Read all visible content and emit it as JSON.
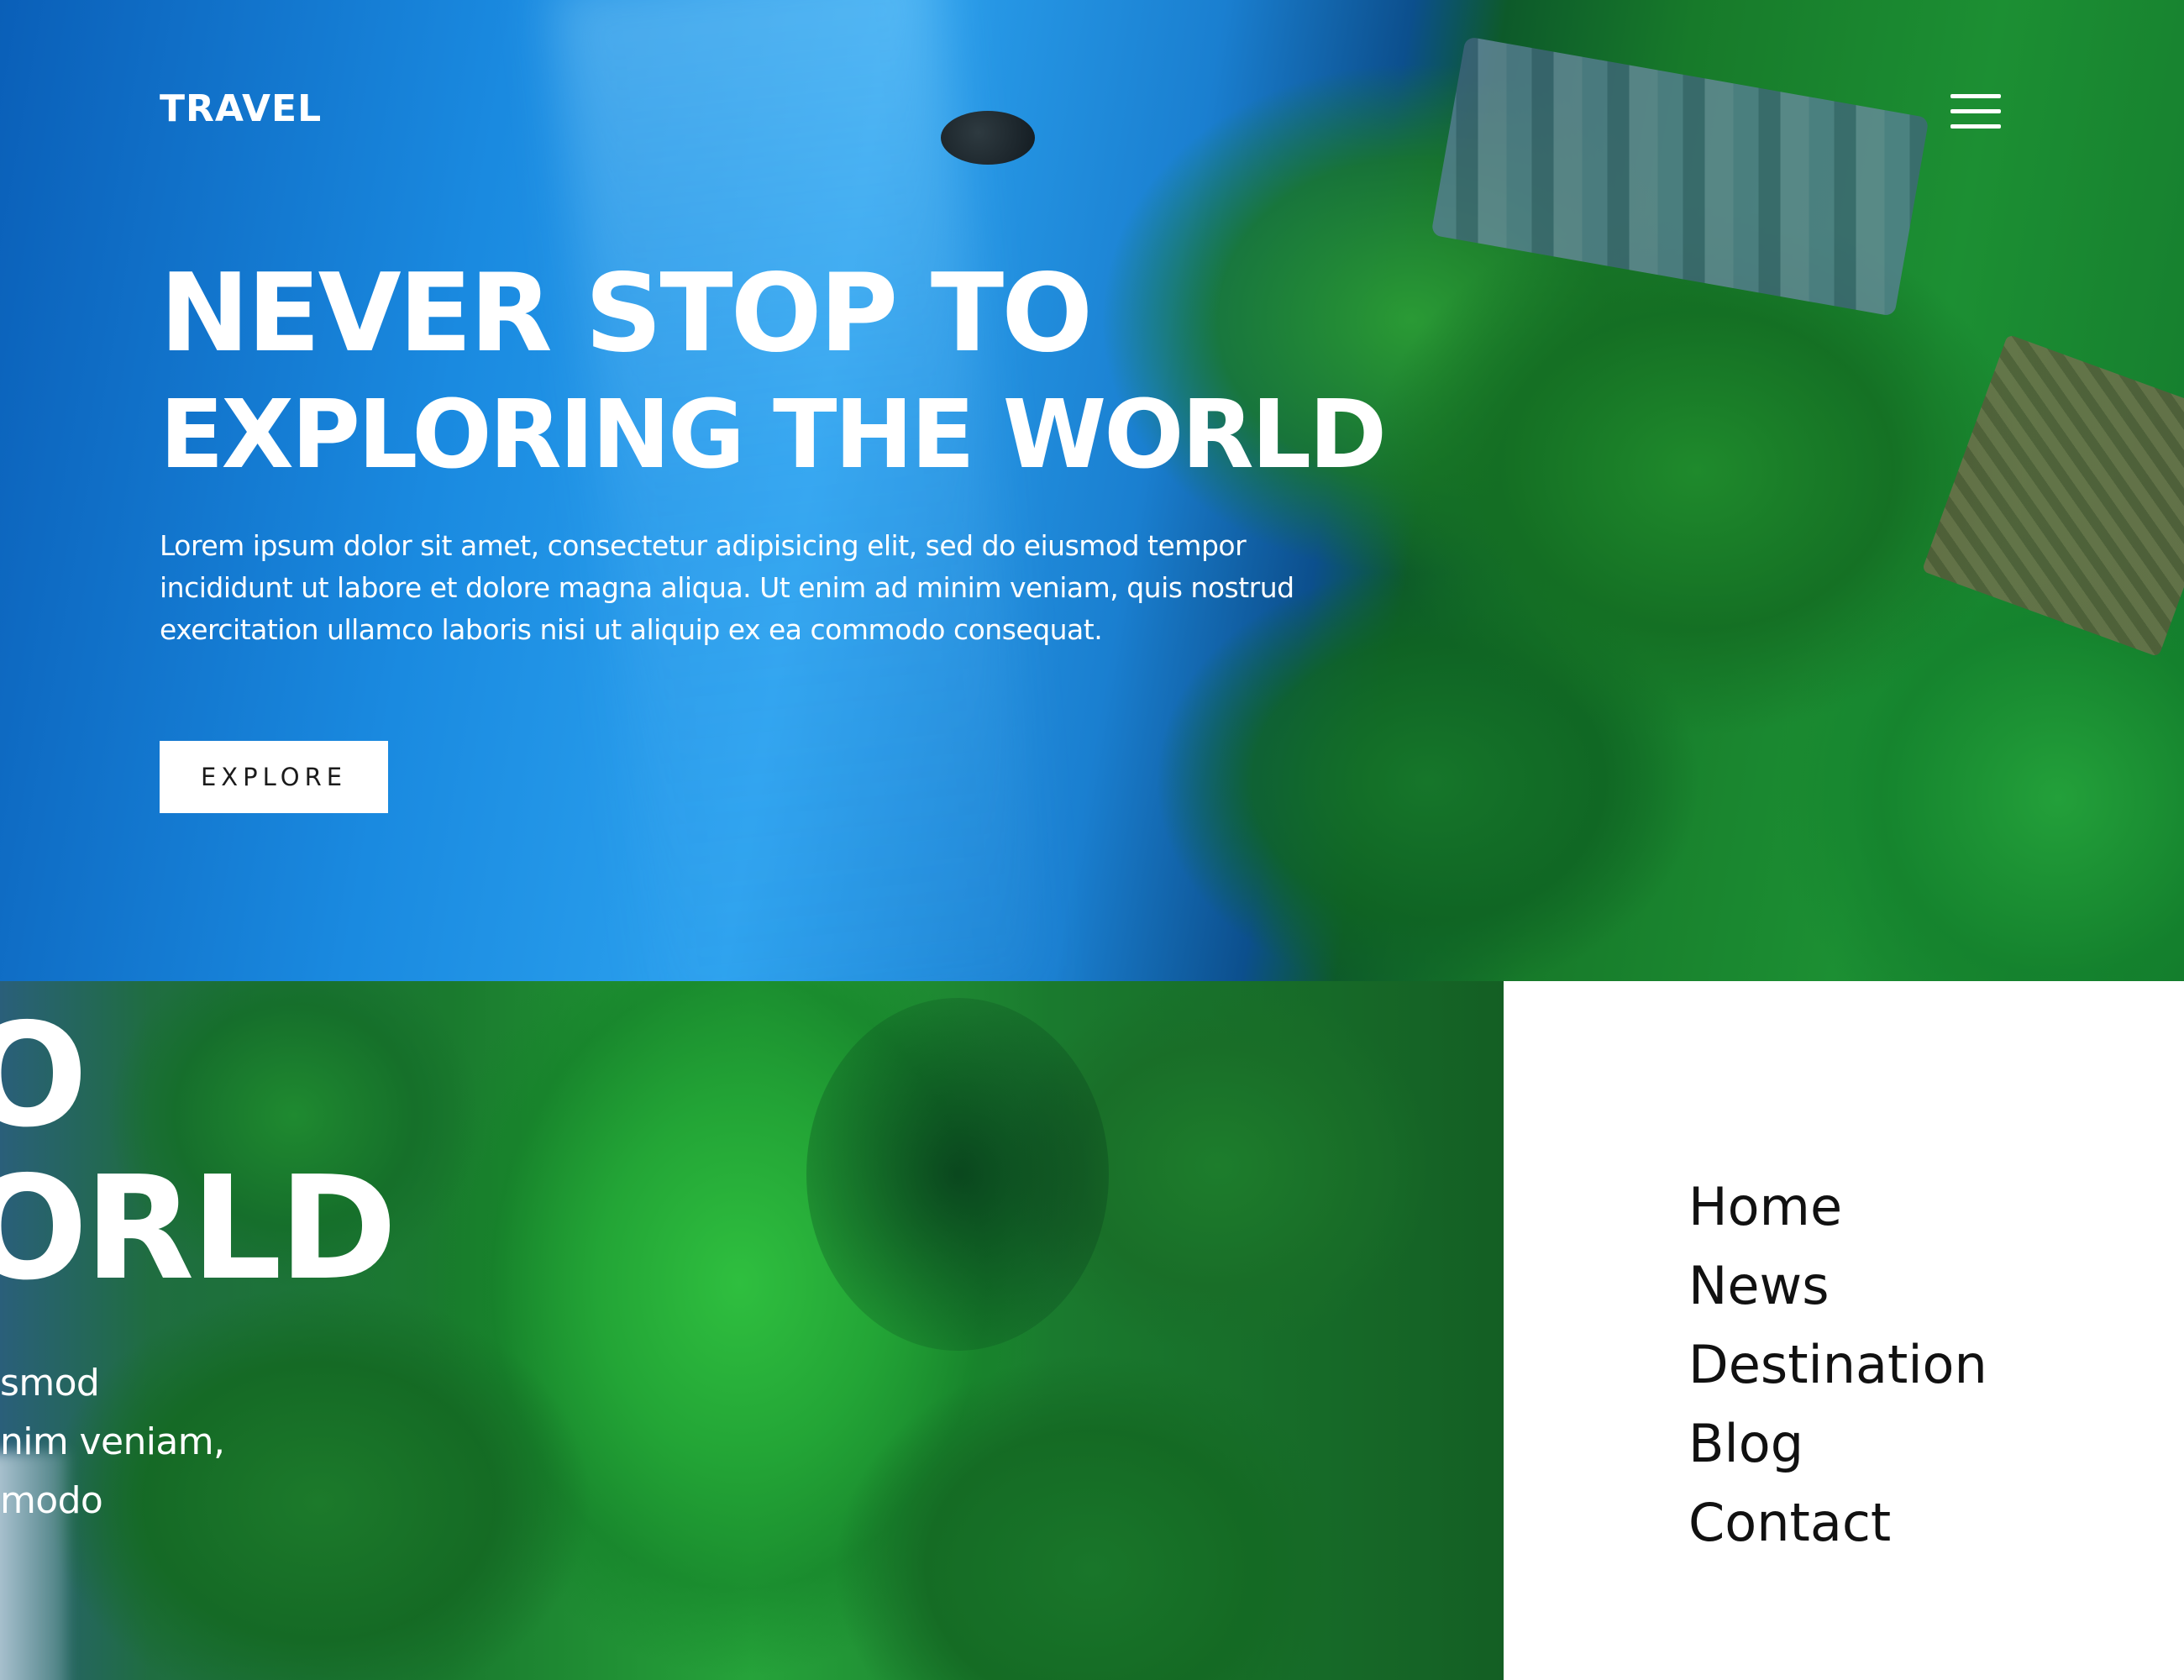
{
  "header": {
    "brand": "TRAVEL",
    "menu_icon": "hamburger-menu-icon"
  },
  "hero": {
    "headline_line1": "NEVER STOP TO",
    "headline_line2": "EXPLORING THE WORLD",
    "paragraph": "Lorem ipsum dolor sit amet, consectetur adipisicing elit, sed do eiusmod tempor incididunt ut labore et dolore magna aliqua. Ut enim ad minim veniam, quis nostrud exercitation ullamco laboris nisi ut aliquip ex ea commodo consequat.",
    "cta_label": "EXPLORE"
  },
  "crop": {
    "h1": "O",
    "h2": "ORLD",
    "p_line1": "smod",
    "p_line2": "nim veniam,",
    "p_line3": "modo"
  },
  "menu": {
    "items": [
      {
        "label": "Home"
      },
      {
        "label": "News"
      },
      {
        "label": "Destination"
      },
      {
        "label": "Blog"
      },
      {
        "label": "Contact"
      }
    ]
  },
  "colors": {
    "text_on_image": "#ffffff",
    "button_bg": "#ffffff",
    "button_text": "#1b1b1b",
    "menu_text": "#111111",
    "menu_bg": "#ffffff"
  }
}
